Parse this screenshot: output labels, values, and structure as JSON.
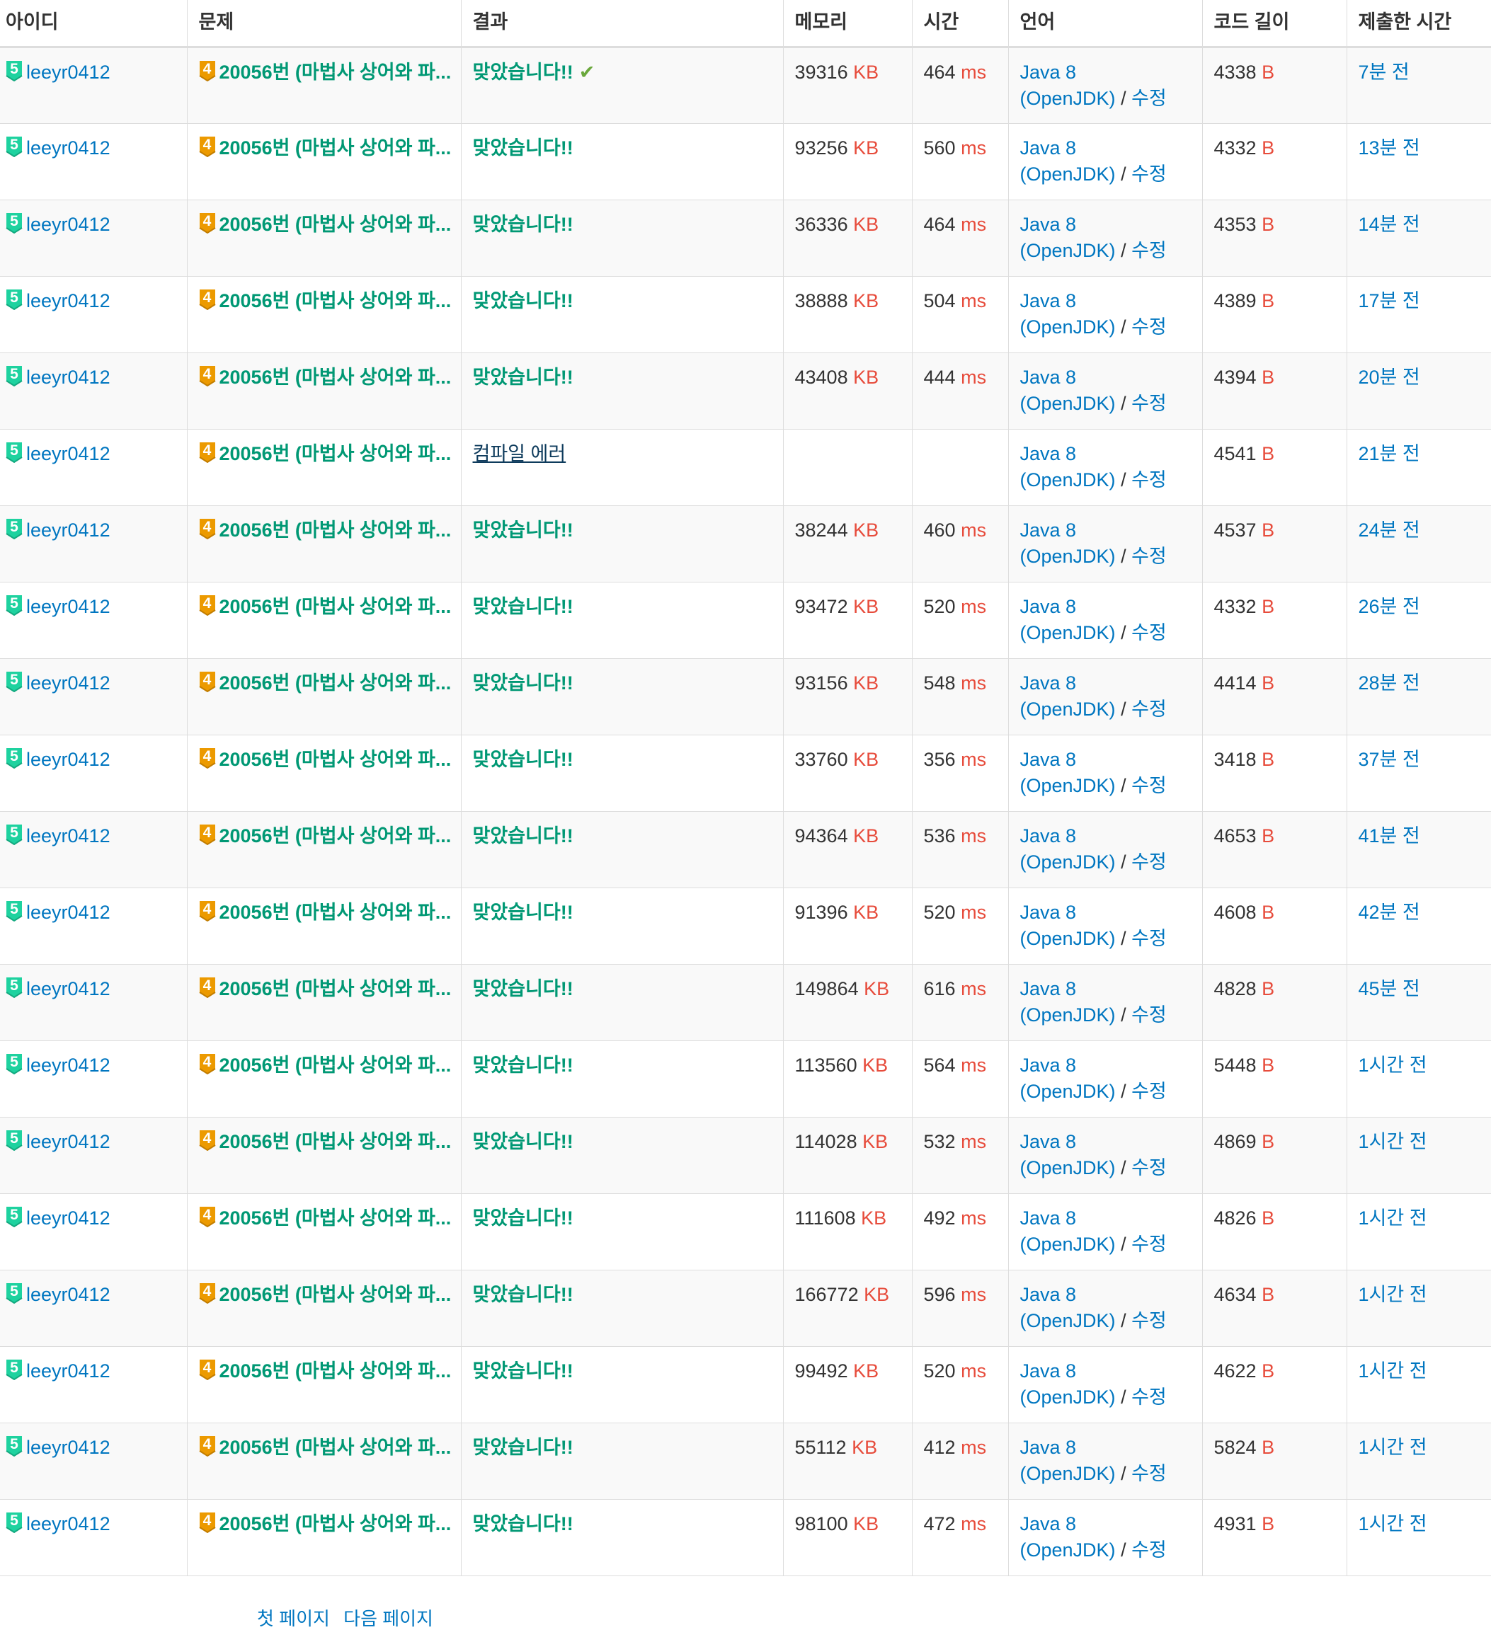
{
  "headers": [
    "아이디",
    "문제",
    "결과",
    "메모리",
    "시간",
    "언어",
    "코드 길이",
    "제출한 시간"
  ],
  "colors": {
    "user_tier_badge": "#1ed29f",
    "problem_tier_badge": "#ec9a00",
    "accepted": "#009874",
    "unit": "#e74c3c",
    "link": "#0076c0"
  },
  "rows": [
    {
      "user_tier": "5",
      "user": "leeyr0412",
      "problem_tier": "4",
      "problem": "20056번 (마법사 상어와 파...",
      "result": "맞았습니다!!",
      "result_type": "ac",
      "latest": true,
      "memory": "39316",
      "memory_unit": "KB",
      "time": "464",
      "time_unit": "ms",
      "lang": "Java 8",
      "lang2": "(OpenJDK)",
      "sep": "/",
      "edit": "수정",
      "code_len": "4338",
      "code_unit": "B",
      "submitted": "7분 전"
    },
    {
      "user_tier": "5",
      "user": "leeyr0412",
      "problem_tier": "4",
      "problem": "20056번 (마법사 상어와 파...",
      "result": "맞았습니다!!",
      "result_type": "ac",
      "memory": "93256",
      "memory_unit": "KB",
      "time": "560",
      "time_unit": "ms",
      "lang": "Java 8",
      "lang2": "(OpenJDK)",
      "sep": "/",
      "edit": "수정",
      "code_len": "4332",
      "code_unit": "B",
      "submitted": "13분 전"
    },
    {
      "user_tier": "5",
      "user": "leeyr0412",
      "problem_tier": "4",
      "problem": "20056번 (마법사 상어와 파...",
      "result": "맞았습니다!!",
      "result_type": "ac",
      "memory": "36336",
      "memory_unit": "KB",
      "time": "464",
      "time_unit": "ms",
      "lang": "Java 8",
      "lang2": "(OpenJDK)",
      "sep": "/",
      "edit": "수정",
      "code_len": "4353",
      "code_unit": "B",
      "submitted": "14분 전"
    },
    {
      "user_tier": "5",
      "user": "leeyr0412",
      "problem_tier": "4",
      "problem": "20056번 (마법사 상어와 파...",
      "result": "맞았습니다!!",
      "result_type": "ac",
      "memory": "38888",
      "memory_unit": "KB",
      "time": "504",
      "time_unit": "ms",
      "lang": "Java 8",
      "lang2": "(OpenJDK)",
      "sep": "/",
      "edit": "수정",
      "code_len": "4389",
      "code_unit": "B",
      "submitted": "17분 전"
    },
    {
      "user_tier": "5",
      "user": "leeyr0412",
      "problem_tier": "4",
      "problem": "20056번 (마법사 상어와 파...",
      "result": "맞았습니다!!",
      "result_type": "ac",
      "memory": "43408",
      "memory_unit": "KB",
      "time": "444",
      "time_unit": "ms",
      "lang": "Java 8",
      "lang2": "(OpenJDK)",
      "sep": "/",
      "edit": "수정",
      "code_len": "4394",
      "code_unit": "B",
      "submitted": "20분 전"
    },
    {
      "user_tier": "5",
      "user": "leeyr0412",
      "problem_tier": "4",
      "problem": "20056번 (마법사 상어와 파...",
      "result": "컴파일 에러",
      "result_type": "ce",
      "memory": "",
      "memory_unit": "",
      "time": "",
      "time_unit": "",
      "lang": "Java 8",
      "lang2": "(OpenJDK)",
      "sep": "/",
      "edit": "수정",
      "code_len": "4541",
      "code_unit": "B",
      "submitted": "21분 전"
    },
    {
      "user_tier": "5",
      "user": "leeyr0412",
      "problem_tier": "4",
      "problem": "20056번 (마법사 상어와 파...",
      "result": "맞았습니다!!",
      "result_type": "ac",
      "memory": "38244",
      "memory_unit": "KB",
      "time": "460",
      "time_unit": "ms",
      "lang": "Java 8",
      "lang2": "(OpenJDK)",
      "sep": "/",
      "edit": "수정",
      "code_len": "4537",
      "code_unit": "B",
      "submitted": "24분 전"
    },
    {
      "user_tier": "5",
      "user": "leeyr0412",
      "problem_tier": "4",
      "problem": "20056번 (마법사 상어와 파...",
      "result": "맞았습니다!!",
      "result_type": "ac",
      "memory": "93472",
      "memory_unit": "KB",
      "time": "520",
      "time_unit": "ms",
      "lang": "Java 8",
      "lang2": "(OpenJDK)",
      "sep": "/",
      "edit": "수정",
      "code_len": "4332",
      "code_unit": "B",
      "submitted": "26분 전"
    },
    {
      "user_tier": "5",
      "user": "leeyr0412",
      "problem_tier": "4",
      "problem": "20056번 (마법사 상어와 파...",
      "result": "맞았습니다!!",
      "result_type": "ac",
      "memory": "93156",
      "memory_unit": "KB",
      "time": "548",
      "time_unit": "ms",
      "lang": "Java 8",
      "lang2": "(OpenJDK)",
      "sep": "/",
      "edit": "수정",
      "code_len": "4414",
      "code_unit": "B",
      "submitted": "28분 전"
    },
    {
      "user_tier": "5",
      "user": "leeyr0412",
      "problem_tier": "4",
      "problem": "20056번 (마법사 상어와 파...",
      "result": "맞았습니다!!",
      "result_type": "ac",
      "memory": "33760",
      "memory_unit": "KB",
      "time": "356",
      "time_unit": "ms",
      "lang": "Java 8",
      "lang2": "(OpenJDK)",
      "sep": "/",
      "edit": "수정",
      "code_len": "3418",
      "code_unit": "B",
      "submitted": "37분 전"
    },
    {
      "user_tier": "5",
      "user": "leeyr0412",
      "problem_tier": "4",
      "problem": "20056번 (마법사 상어와 파...",
      "result": "맞았습니다!!",
      "result_type": "ac",
      "memory": "94364",
      "memory_unit": "KB",
      "time": "536",
      "time_unit": "ms",
      "lang": "Java 8",
      "lang2": "(OpenJDK)",
      "sep": "/",
      "edit": "수정",
      "code_len": "4653",
      "code_unit": "B",
      "submitted": "41분 전"
    },
    {
      "user_tier": "5",
      "user": "leeyr0412",
      "problem_tier": "4",
      "problem": "20056번 (마법사 상어와 파...",
      "result": "맞았습니다!!",
      "result_type": "ac",
      "memory": "91396",
      "memory_unit": "KB",
      "time": "520",
      "time_unit": "ms",
      "lang": "Java 8",
      "lang2": "(OpenJDK)",
      "sep": "/",
      "edit": "수정",
      "code_len": "4608",
      "code_unit": "B",
      "submitted": "42분 전"
    },
    {
      "user_tier": "5",
      "user": "leeyr0412",
      "problem_tier": "4",
      "problem": "20056번 (마법사 상어와 파...",
      "result": "맞았습니다!!",
      "result_type": "ac",
      "memory": "149864",
      "memory_unit": "KB",
      "time": "616",
      "time_unit": "ms",
      "lang": "Java 8",
      "lang2": "(OpenJDK)",
      "sep": "/",
      "edit": "수정",
      "code_len": "4828",
      "code_unit": "B",
      "submitted": "45분 전"
    },
    {
      "user_tier": "5",
      "user": "leeyr0412",
      "problem_tier": "4",
      "problem": "20056번 (마법사 상어와 파...",
      "result": "맞았습니다!!",
      "result_type": "ac",
      "memory": "113560",
      "memory_unit": "KB",
      "time": "564",
      "time_unit": "ms",
      "lang": "Java 8",
      "lang2": "(OpenJDK)",
      "sep": "/",
      "edit": "수정",
      "code_len": "5448",
      "code_unit": "B",
      "submitted": "1시간 전"
    },
    {
      "user_tier": "5",
      "user": "leeyr0412",
      "problem_tier": "4",
      "problem": "20056번 (마법사 상어와 파...",
      "result": "맞았습니다!!",
      "result_type": "ac",
      "memory": "114028",
      "memory_unit": "KB",
      "time": "532",
      "time_unit": "ms",
      "lang": "Java 8",
      "lang2": "(OpenJDK)",
      "sep": "/",
      "edit": "수정",
      "code_len": "4869",
      "code_unit": "B",
      "submitted": "1시간 전"
    },
    {
      "user_tier": "5",
      "user": "leeyr0412",
      "problem_tier": "4",
      "problem": "20056번 (마법사 상어와 파...",
      "result": "맞았습니다!!",
      "result_type": "ac",
      "memory": "111608",
      "memory_unit": "KB",
      "time": "492",
      "time_unit": "ms",
      "lang": "Java 8",
      "lang2": "(OpenJDK)",
      "sep": "/",
      "edit": "수정",
      "code_len": "4826",
      "code_unit": "B",
      "submitted": "1시간 전"
    },
    {
      "user_tier": "5",
      "user": "leeyr0412",
      "problem_tier": "4",
      "problem": "20056번 (마법사 상어와 파...",
      "result": "맞았습니다!!",
      "result_type": "ac",
      "memory": "166772",
      "memory_unit": "KB",
      "time": "596",
      "time_unit": "ms",
      "lang": "Java 8",
      "lang2": "(OpenJDK)",
      "sep": "/",
      "edit": "수정",
      "code_len": "4634",
      "code_unit": "B",
      "submitted": "1시간 전"
    },
    {
      "user_tier": "5",
      "user": "leeyr0412",
      "problem_tier": "4",
      "problem": "20056번 (마법사 상어와 파...",
      "result": "맞았습니다!!",
      "result_type": "ac",
      "memory": "99492",
      "memory_unit": "KB",
      "time": "520",
      "time_unit": "ms",
      "lang": "Java 8",
      "lang2": "(OpenJDK)",
      "sep": "/",
      "edit": "수정",
      "code_len": "4622",
      "code_unit": "B",
      "submitted": "1시간 전"
    },
    {
      "user_tier": "5",
      "user": "leeyr0412",
      "problem_tier": "4",
      "problem": "20056번 (마법사 상어와 파...",
      "result": "맞았습니다!!",
      "result_type": "ac",
      "memory": "55112",
      "memory_unit": "KB",
      "time": "412",
      "time_unit": "ms",
      "lang": "Java 8",
      "lang2": "(OpenJDK)",
      "sep": "/",
      "edit": "수정",
      "code_len": "5824",
      "code_unit": "B",
      "submitted": "1시간 전"
    },
    {
      "user_tier": "5",
      "user": "leeyr0412",
      "problem_tier": "4",
      "problem": "20056번 (마법사 상어와 파...",
      "result": "맞았습니다!!",
      "result_type": "ac",
      "memory": "98100",
      "memory_unit": "KB",
      "time": "472",
      "time_unit": "ms",
      "lang": "Java 8",
      "lang2": "(OpenJDK)",
      "sep": "/",
      "edit": "수정",
      "code_len": "4931",
      "code_unit": "B",
      "submitted": "1시간 전"
    }
  ],
  "check_icon": "checkmark-icon",
  "pagination": {
    "first": "첫 페이지",
    "next": "다음 페이지"
  }
}
